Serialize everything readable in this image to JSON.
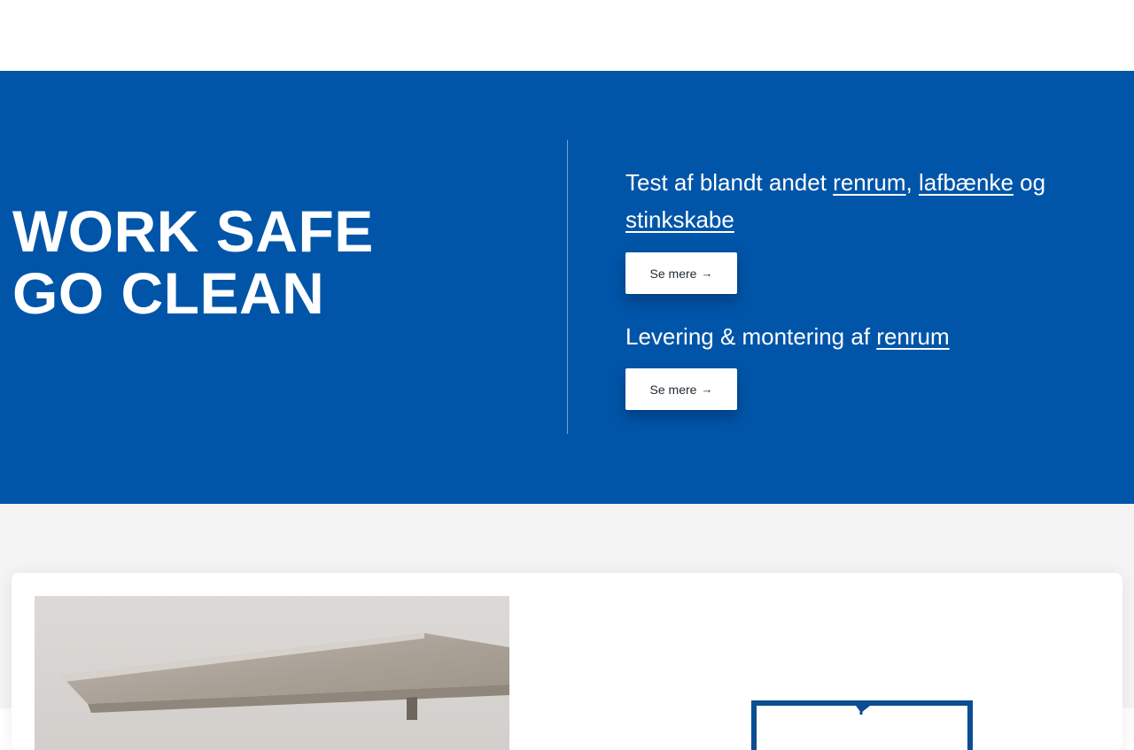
{
  "hero": {
    "title_line1": "WORK SAFE",
    "title_line2": "GO CLEAN",
    "offers": [
      {
        "text_before": "Test af blandt andet ",
        "links": [
          "renrum",
          "lafbænke",
          "stinkskabe"
        ],
        "sep1": ", ",
        "sep2": " og ",
        "button_label": "Se mere",
        "button_icon": "→"
      },
      {
        "text_before": "Levering & montering af ",
        "links": [
          "renrum"
        ],
        "button_label": "Se mere",
        "button_icon": "→"
      }
    ]
  },
  "colors": {
    "hero_bg": "#0055a8",
    "section_bg": "#f4f4f4",
    "logo_blue": "#0a4d93"
  },
  "icons": {
    "button_arrow": "arrow-right-icon"
  }
}
